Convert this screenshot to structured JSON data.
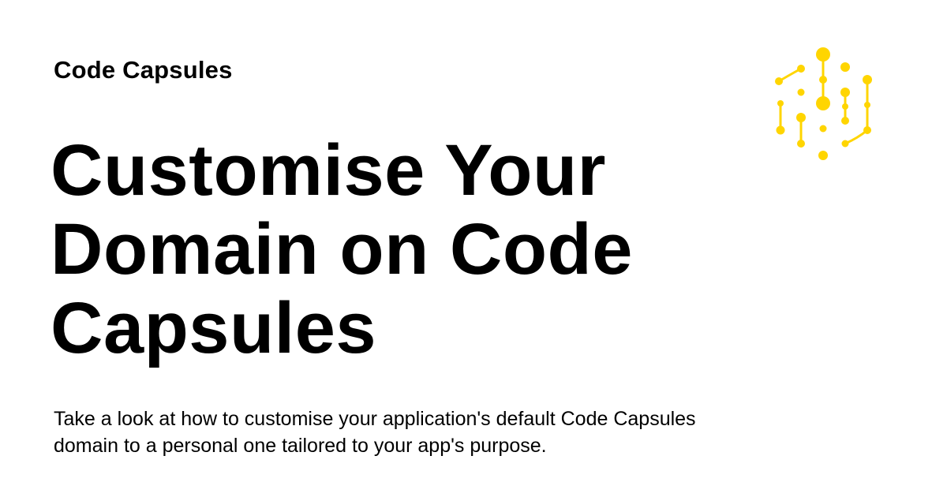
{
  "brand": {
    "name": "Code Capsules",
    "logo_icon": "code-capsules-logo-icon",
    "logo_color": "#FFD500"
  },
  "article": {
    "title": "Customise Your Domain on Code Capsules",
    "description": "Take a look at how to customise your application's default Code Capsules domain to a personal one tailored to your app's purpose."
  },
  "colors": {
    "background": "#FFFFFF",
    "text": "#000000"
  }
}
